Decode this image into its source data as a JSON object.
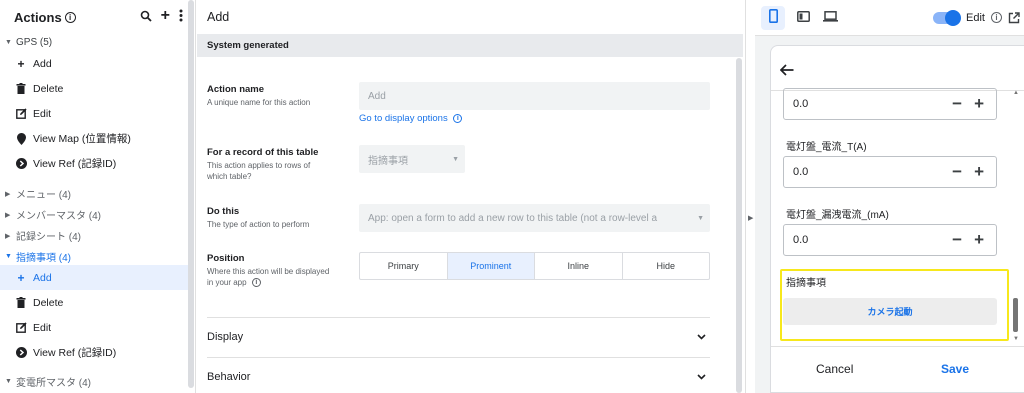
{
  "sidebar": {
    "title": "Actions",
    "groups": [
      {
        "label": "GPS (5)",
        "open": true,
        "items": [
          "Add",
          "Delete",
          "Edit",
          "View Map (位置情報)",
          "View Ref (記録ID)"
        ]
      },
      {
        "label": "メニュー (4)"
      },
      {
        "label": "メンバーマスタ (4)"
      },
      {
        "label": "記録シート (4)"
      },
      {
        "label": "指摘事項 (4)",
        "open": true,
        "items": [
          "Add",
          "Delete",
          "Edit",
          "View Ref (記録ID)"
        ]
      },
      {
        "label": "変電所マスタ (4)"
      }
    ]
  },
  "main": {
    "title": "Add",
    "section": "System generated",
    "action_name": {
      "label": "Action name",
      "desc": "A unique name for this action",
      "placeholder": "Add",
      "link": "Go to display options"
    },
    "record_table": {
      "label": "For a record of this table",
      "desc1": "This action applies to rows of",
      "desc2": "which table?",
      "value": "指摘事項"
    },
    "do_this": {
      "label": "Do this",
      "desc": "The type of action to perform",
      "value": "App: open a form to add a new row to this table (not a row-level a"
    },
    "position": {
      "label": "Position",
      "desc1": "Where this action will be displayed",
      "desc2": "in your app",
      "options": [
        "Primary",
        "Prominent",
        "Inline",
        "Hide"
      ],
      "selected": "Prominent"
    },
    "accordions": [
      "Display",
      "Behavior"
    ]
  },
  "preview": {
    "edit_label": "Edit",
    "fields": [
      {
        "label": "",
        "value": "0.0"
      },
      {
        "label": "電灯盤_電流_T(A)",
        "value": "0.0"
      },
      {
        "label": "電灯盤_漏洩電流_(mA)",
        "value": "0.0"
      }
    ],
    "section_label": "指摘事項",
    "camera_button": "カメラ起動",
    "cancel": "Cancel",
    "save": "Save"
  },
  "colors": {
    "accent": "#1a73e8",
    "highlight": "#f7e81c",
    "selected_bg": "#e8f0fe"
  }
}
